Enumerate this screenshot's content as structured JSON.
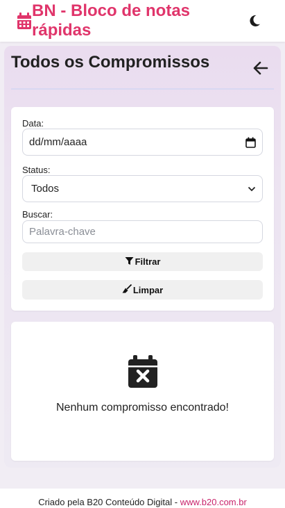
{
  "header": {
    "title": "BN - Bloco de notas rápidas",
    "brand_icon": "calendar-icon",
    "theme_icon": "moon-icon",
    "brand_color": "#e0356b"
  },
  "page": {
    "title": "Todos os Compromissos",
    "back_icon": "arrow-left-icon"
  },
  "filters": {
    "date_label": "Data:",
    "date_value": "dd/mm/aaaa",
    "status_label": "Status:",
    "status_value": "Todos",
    "search_label": "Buscar:",
    "search_placeholder": "Palavra-chave",
    "filter_button": "Filtrar",
    "clear_button": "Limpar"
  },
  "empty_state": {
    "icon": "calendar-x-icon",
    "message": "Nenhum compromisso encontrado!"
  },
  "footer": {
    "text": "Criado pela B20 Conteúdo Digital - ",
    "link": "www.b20.com.br",
    "link_color": "#c8246b"
  }
}
